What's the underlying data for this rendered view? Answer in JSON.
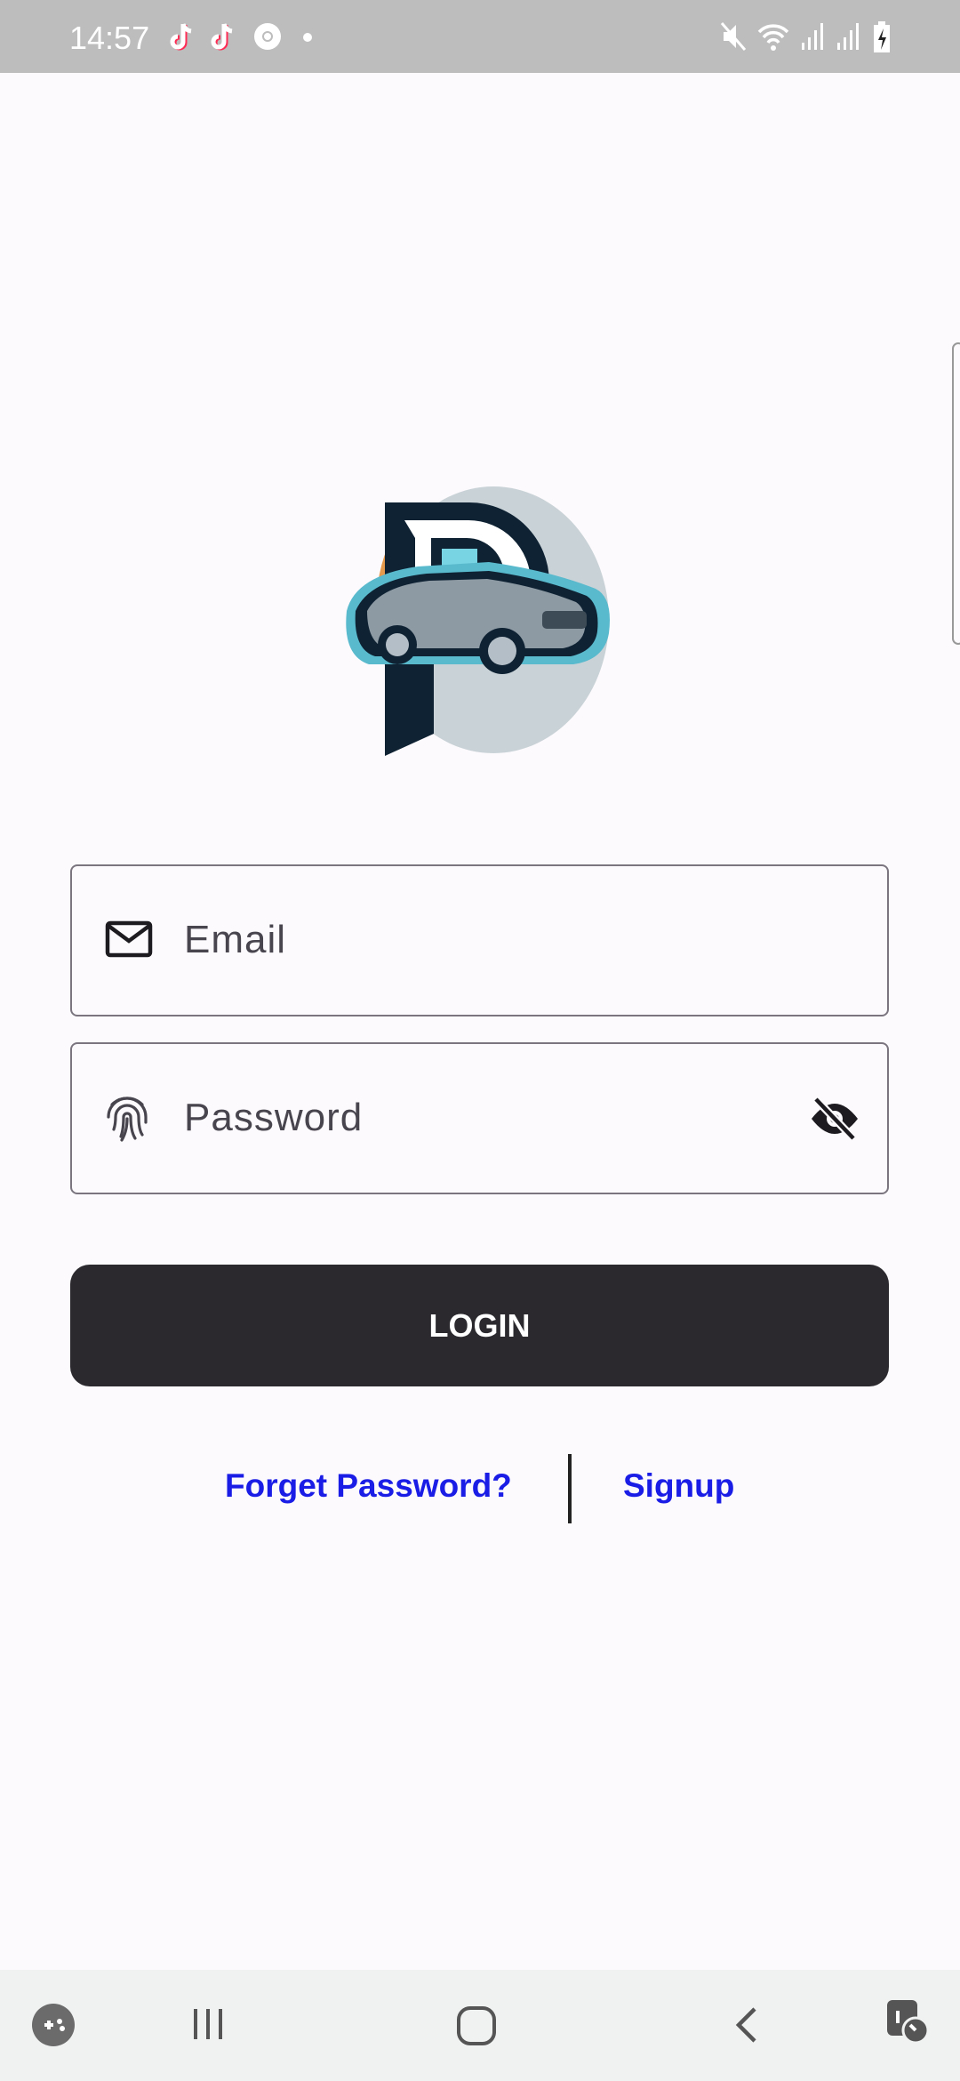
{
  "status_bar": {
    "time": "14:57",
    "icons": [
      "tiktok-icon",
      "tiktok-icon",
      "chrome-icon",
      "dot-icon",
      "mute-icon",
      "wifi-icon",
      "signal-icon",
      "signal-icon",
      "battery-charging-icon"
    ]
  },
  "login_form": {
    "email": {
      "placeholder": "Email",
      "icon": "mail-icon"
    },
    "password": {
      "placeholder": "Password",
      "icon": "fingerprint-icon",
      "toggle_icon": "eye-off-icon"
    },
    "login_label": "LOGIN",
    "forget_password_label": "Forget Password?",
    "signup_label": "Signup"
  },
  "colors": {
    "accent_link": "#1a1de6",
    "button_bg": "#2b292e",
    "status_bar": "#bebdbd"
  },
  "nav_bar": {
    "icons": [
      "game-launcher-icon",
      "recents-icon",
      "home-icon",
      "back-icon",
      "accessibility-icon"
    ]
  }
}
